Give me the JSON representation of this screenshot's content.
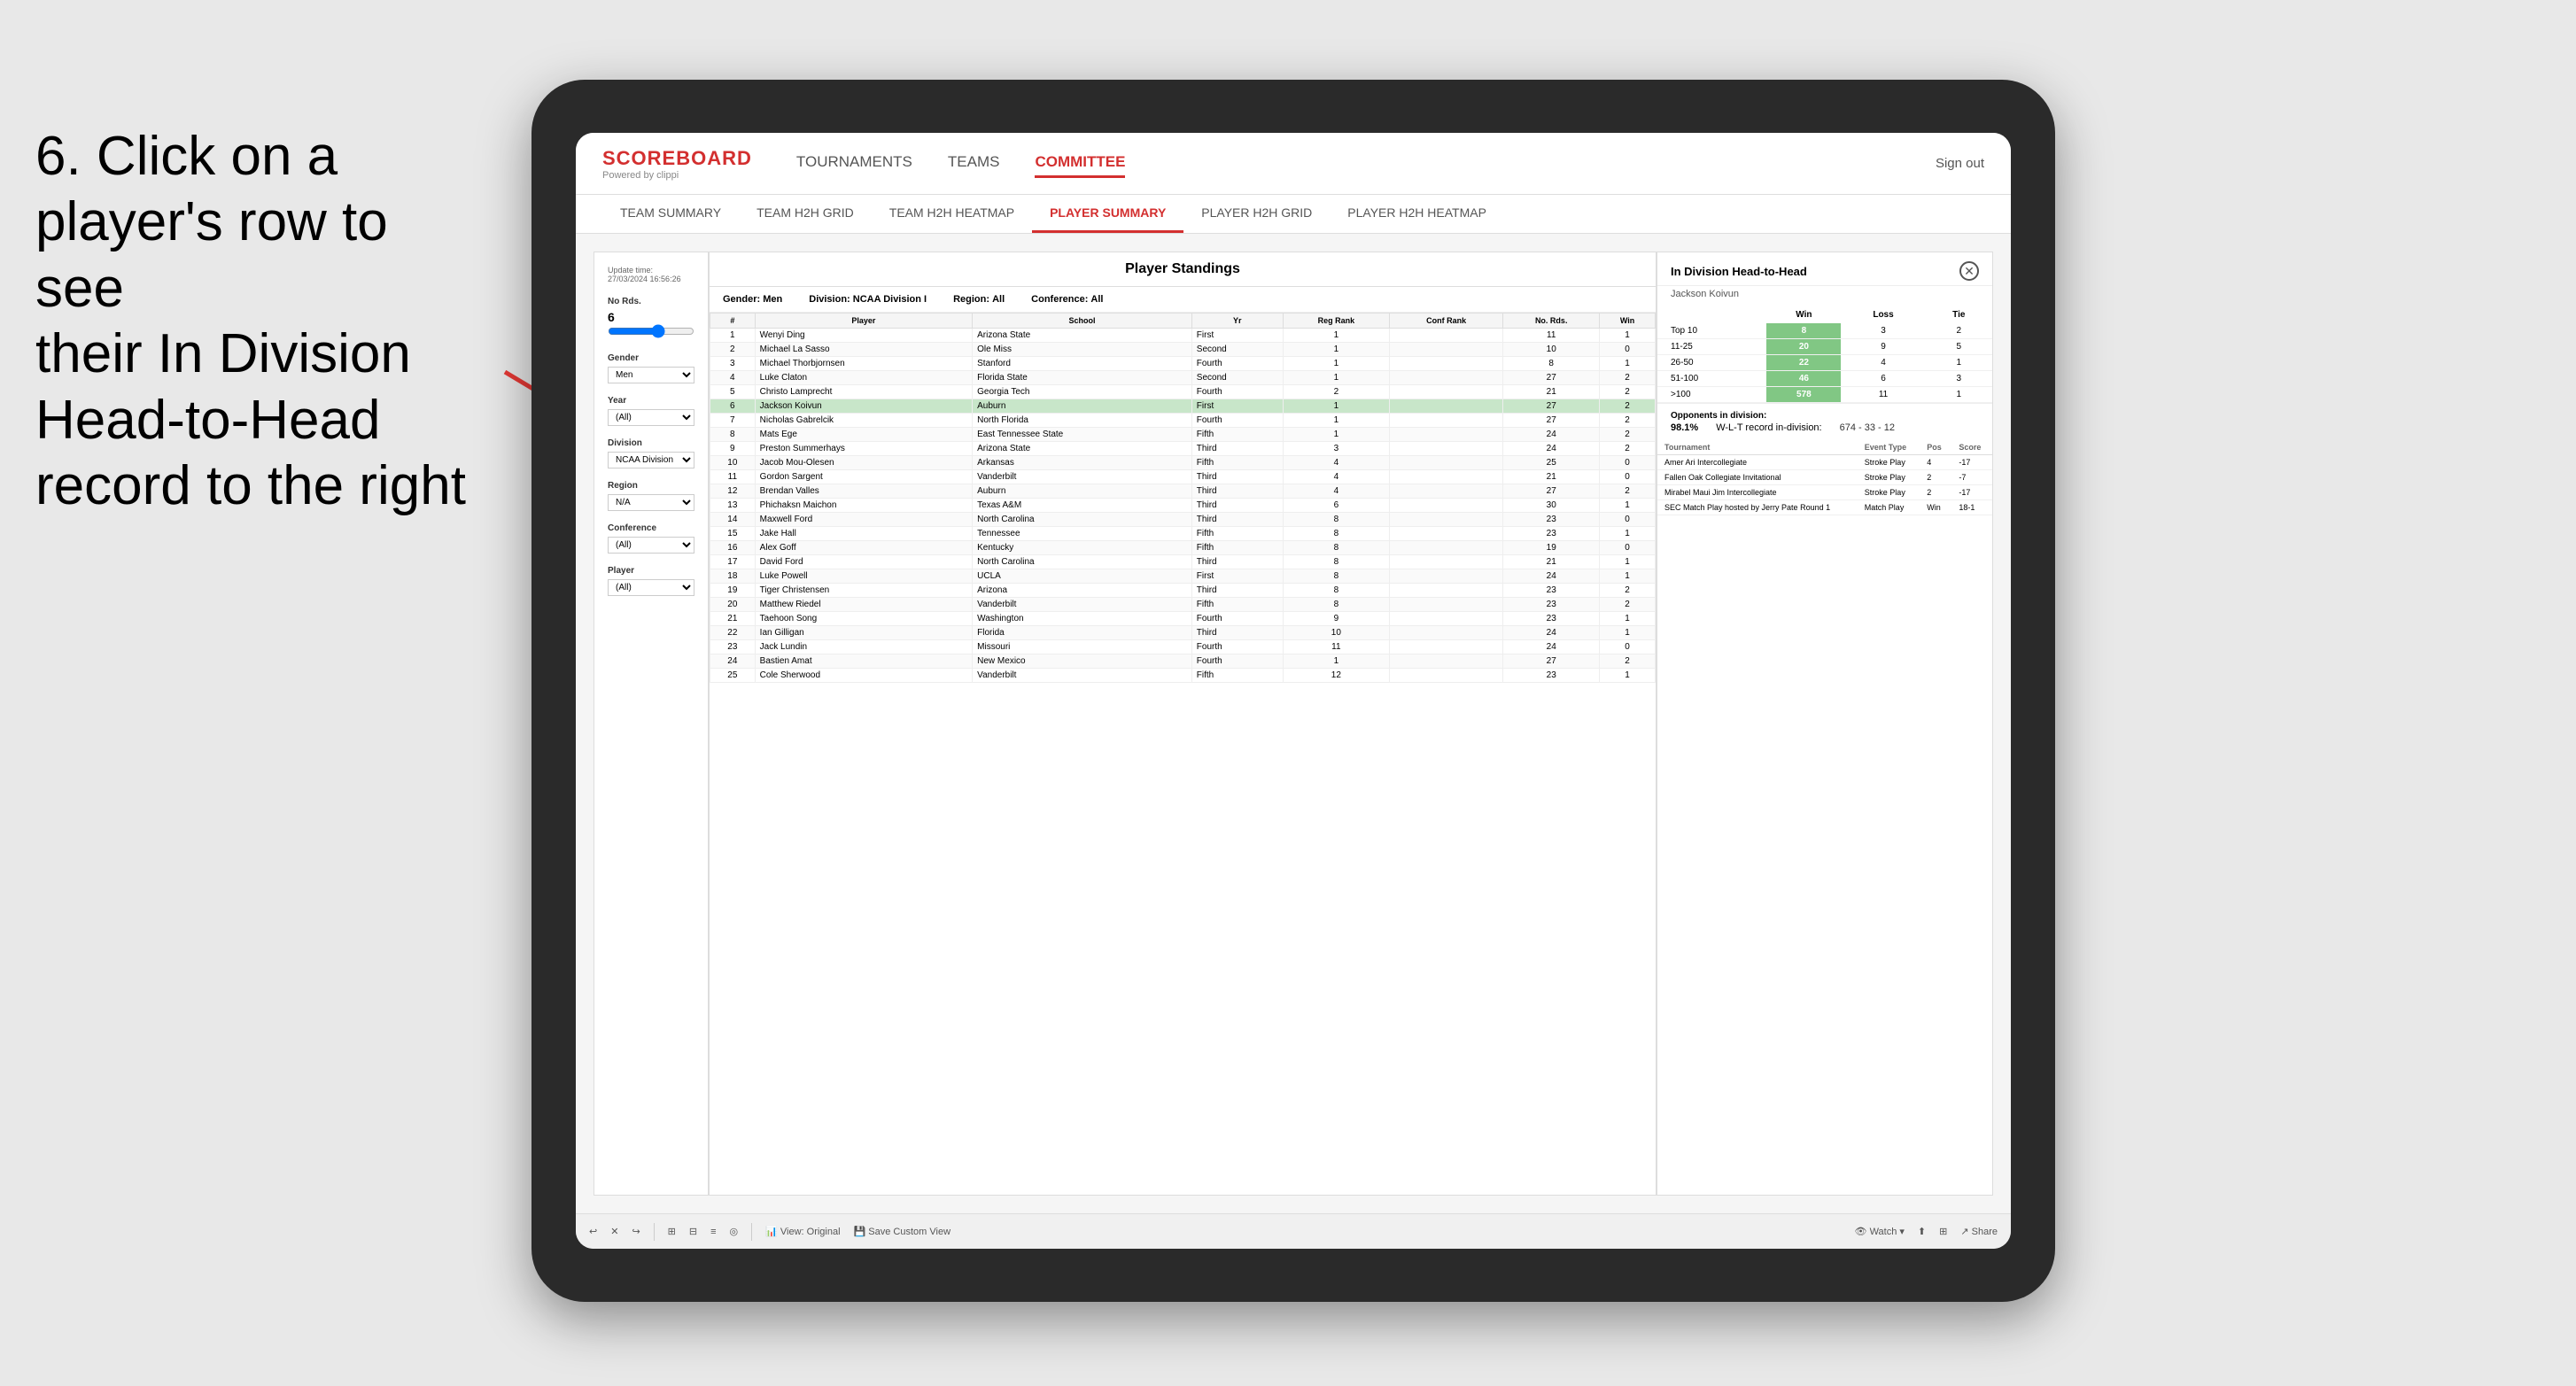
{
  "instruction": {
    "line1": "6. Click on a",
    "line2": "player's row to see",
    "line3": "their In Division",
    "line4": "Head-to-Head",
    "line5": "record to the right"
  },
  "nav": {
    "logo_title": "SCOREBOARD",
    "logo_subtitle": "Powered by clippi",
    "items": [
      "TOURNAMENTS",
      "TEAMS",
      "COMMITTEE"
    ],
    "sign_out": "Sign out"
  },
  "sub_nav": {
    "items": [
      "TEAM SUMMARY",
      "TEAM H2H GRID",
      "TEAM H2H HEATMAP",
      "PLAYER SUMMARY",
      "PLAYER H2H GRID",
      "PLAYER H2H HEATMAP"
    ],
    "active": "PLAYER SUMMARY"
  },
  "filter_panel": {
    "update_label": "Update time:",
    "update_time": "27/03/2024 16:56:26",
    "no_rds_label": "No Rds.",
    "no_rds_value": "6",
    "gender_label": "Gender",
    "gender_value": "Men",
    "year_label": "Year",
    "year_value": "(All)",
    "division_label": "Division",
    "division_value": "NCAA Division I",
    "region_label": "Region",
    "region_value": "N/A",
    "conference_label": "Conference",
    "conference_value": "(All)",
    "player_label": "Player",
    "player_value": "(All)"
  },
  "standings": {
    "title": "Player Standings",
    "gender_label": "Gender:",
    "gender_value": "Men",
    "division_label": "Division:",
    "division_value": "NCAA Division I",
    "region_label": "Region:",
    "region_value": "All",
    "conference_label": "Conference:",
    "conference_value": "All",
    "columns": [
      "#",
      "Player",
      "School",
      "Yr",
      "Reg Rank",
      "Conf Rank",
      "No. Rds.",
      "Win"
    ],
    "rows": [
      {
        "rank": 1,
        "player": "Wenyi Ding",
        "school": "Arizona State",
        "yr": "First",
        "reg_rank": 1,
        "conf_rank": "",
        "no_rds": 11,
        "win": 1
      },
      {
        "rank": 2,
        "player": "Michael La Sasso",
        "school": "Ole Miss",
        "yr": "Second",
        "reg_rank": 1,
        "conf_rank": "",
        "no_rds": 10,
        "win": 0
      },
      {
        "rank": 3,
        "player": "Michael Thorbjornsen",
        "school": "Stanford",
        "yr": "Fourth",
        "reg_rank": 1,
        "conf_rank": "",
        "no_rds": 8,
        "win": 1
      },
      {
        "rank": 4,
        "player": "Luke Claton",
        "school": "Florida State",
        "yr": "Second",
        "reg_rank": 1,
        "conf_rank": "",
        "no_rds": 27,
        "win": 2
      },
      {
        "rank": 5,
        "player": "Christo Lamprecht",
        "school": "Georgia Tech",
        "yr": "Fourth",
        "reg_rank": 2,
        "conf_rank": "",
        "no_rds": 21,
        "win": 2
      },
      {
        "rank": 6,
        "player": "Jackson Koivun",
        "school": "Auburn",
        "yr": "First",
        "reg_rank": 1,
        "conf_rank": "",
        "no_rds": 27,
        "win": 2,
        "highlighted": true
      },
      {
        "rank": 7,
        "player": "Nicholas Gabrelcik",
        "school": "North Florida",
        "yr": "Fourth",
        "reg_rank": 1,
        "conf_rank": "",
        "no_rds": 27,
        "win": 2
      },
      {
        "rank": 8,
        "player": "Mats Ege",
        "school": "East Tennessee State",
        "yr": "Fifth",
        "reg_rank": 1,
        "conf_rank": "",
        "no_rds": 24,
        "win": 2
      },
      {
        "rank": 9,
        "player": "Preston Summerhays",
        "school": "Arizona State",
        "yr": "Third",
        "reg_rank": 3,
        "conf_rank": "",
        "no_rds": 24,
        "win": 2
      },
      {
        "rank": 10,
        "player": "Jacob Mou-Olesen",
        "school": "Arkansas",
        "yr": "Fifth",
        "reg_rank": 4,
        "conf_rank": "",
        "no_rds": 25,
        "win": 0
      },
      {
        "rank": 11,
        "player": "Gordon Sargent",
        "school": "Vanderbilt",
        "yr": "Third",
        "reg_rank": 4,
        "conf_rank": "",
        "no_rds": 21,
        "win": 0
      },
      {
        "rank": 12,
        "player": "Brendan Valles",
        "school": "Auburn",
        "yr": "Third",
        "reg_rank": 4,
        "conf_rank": "",
        "no_rds": 27,
        "win": 2
      },
      {
        "rank": 13,
        "player": "Phichaksn Maichon",
        "school": "Texas A&M",
        "yr": "Third",
        "reg_rank": 6,
        "conf_rank": "",
        "no_rds": 30,
        "win": 1
      },
      {
        "rank": 14,
        "player": "Maxwell Ford",
        "school": "North Carolina",
        "yr": "Third",
        "reg_rank": 8,
        "conf_rank": "",
        "no_rds": 23,
        "win": 0
      },
      {
        "rank": 15,
        "player": "Jake Hall",
        "school": "Tennessee",
        "yr": "Fifth",
        "reg_rank": 8,
        "conf_rank": "",
        "no_rds": 23,
        "win": 1
      },
      {
        "rank": 16,
        "player": "Alex Goff",
        "school": "Kentucky",
        "yr": "Fifth",
        "reg_rank": 8,
        "conf_rank": "",
        "no_rds": 19,
        "win": 0
      },
      {
        "rank": 17,
        "player": "David Ford",
        "school": "North Carolina",
        "yr": "Third",
        "reg_rank": 8,
        "conf_rank": "",
        "no_rds": 21,
        "win": 1
      },
      {
        "rank": 18,
        "player": "Luke Powell",
        "school": "UCLA",
        "yr": "First",
        "reg_rank": 8,
        "conf_rank": "",
        "no_rds": 24,
        "win": 1
      },
      {
        "rank": 19,
        "player": "Tiger Christensen",
        "school": "Arizona",
        "yr": "Third",
        "reg_rank": 8,
        "conf_rank": "",
        "no_rds": 23,
        "win": 2
      },
      {
        "rank": 20,
        "player": "Matthew Riedel",
        "school": "Vanderbilt",
        "yr": "Fifth",
        "reg_rank": 8,
        "conf_rank": "",
        "no_rds": 23,
        "win": 2
      },
      {
        "rank": 21,
        "player": "Taehoon Song",
        "school": "Washington",
        "yr": "Fourth",
        "reg_rank": 9,
        "conf_rank": "",
        "no_rds": 23,
        "win": 1
      },
      {
        "rank": 22,
        "player": "Ian Gilligan",
        "school": "Florida",
        "yr": "Third",
        "reg_rank": 10,
        "conf_rank": "",
        "no_rds": 24,
        "win": 1
      },
      {
        "rank": 23,
        "player": "Jack Lundin",
        "school": "Missouri",
        "yr": "Fourth",
        "reg_rank": 11,
        "conf_rank": "",
        "no_rds": 24,
        "win": 0
      },
      {
        "rank": 24,
        "player": "Bastien Amat",
        "school": "New Mexico",
        "yr": "Fourth",
        "reg_rank": 1,
        "conf_rank": "",
        "no_rds": 27,
        "win": 2
      },
      {
        "rank": 25,
        "player": "Cole Sherwood",
        "school": "Vanderbilt",
        "yr": "Fifth",
        "reg_rank": 12,
        "conf_rank": "",
        "no_rds": 23,
        "win": 1
      }
    ]
  },
  "h2h": {
    "title": "In Division Head-to-Head",
    "player_name": "Jackson Koivun",
    "columns": [
      "Win",
      "Loss",
      "Tie"
    ],
    "rows": [
      {
        "label": "Top 10",
        "win": 8,
        "loss": 3,
        "tie": 2
      },
      {
        "label": "11-25",
        "win": 20,
        "loss": 9,
        "tie": 5
      },
      {
        "label": "26-50",
        "win": 22,
        "loss": 4,
        "tie": 1
      },
      {
        "label": "51-100",
        "win": 46,
        "loss": 6,
        "tie": 3
      },
      {
        "label": ">100",
        "win": 578,
        "loss": 11,
        "tie": 1
      }
    ],
    "opponents_label": "Opponents in division:",
    "opponents_pct": "98.1%",
    "wlt_label": "W-L-T record in-division:",
    "wlt_record": "674 - 33 - 12",
    "tournament_columns": [
      "Tournament",
      "Event Type",
      "Pos",
      "Score"
    ],
    "tournaments": [
      {
        "name": "Amer Ari Intercollegiate",
        "type": "Stroke Play",
        "pos": 4,
        "score": "-17"
      },
      {
        "name": "Fallen Oak Collegiate Invitational",
        "type": "Stroke Play",
        "pos": 2,
        "score": "-7"
      },
      {
        "name": "Mirabel Maui Jim Intercollegiate",
        "type": "Stroke Play",
        "pos": 2,
        "score": "-17"
      },
      {
        "name": "SEC Match Play hosted by Jerry Pate Round 1",
        "type": "Match Play",
        "pos": "Win",
        "score": "18-1"
      }
    ]
  },
  "toolbar": {
    "buttons": [
      "⟲",
      "×",
      "⟳",
      "⊞",
      "⊟",
      "≡",
      "◎",
      "View: Original",
      "Save Custom View"
    ],
    "right_buttons": [
      "👁 Watch ▾",
      "⬆",
      "⊞",
      "↗ Share"
    ]
  }
}
